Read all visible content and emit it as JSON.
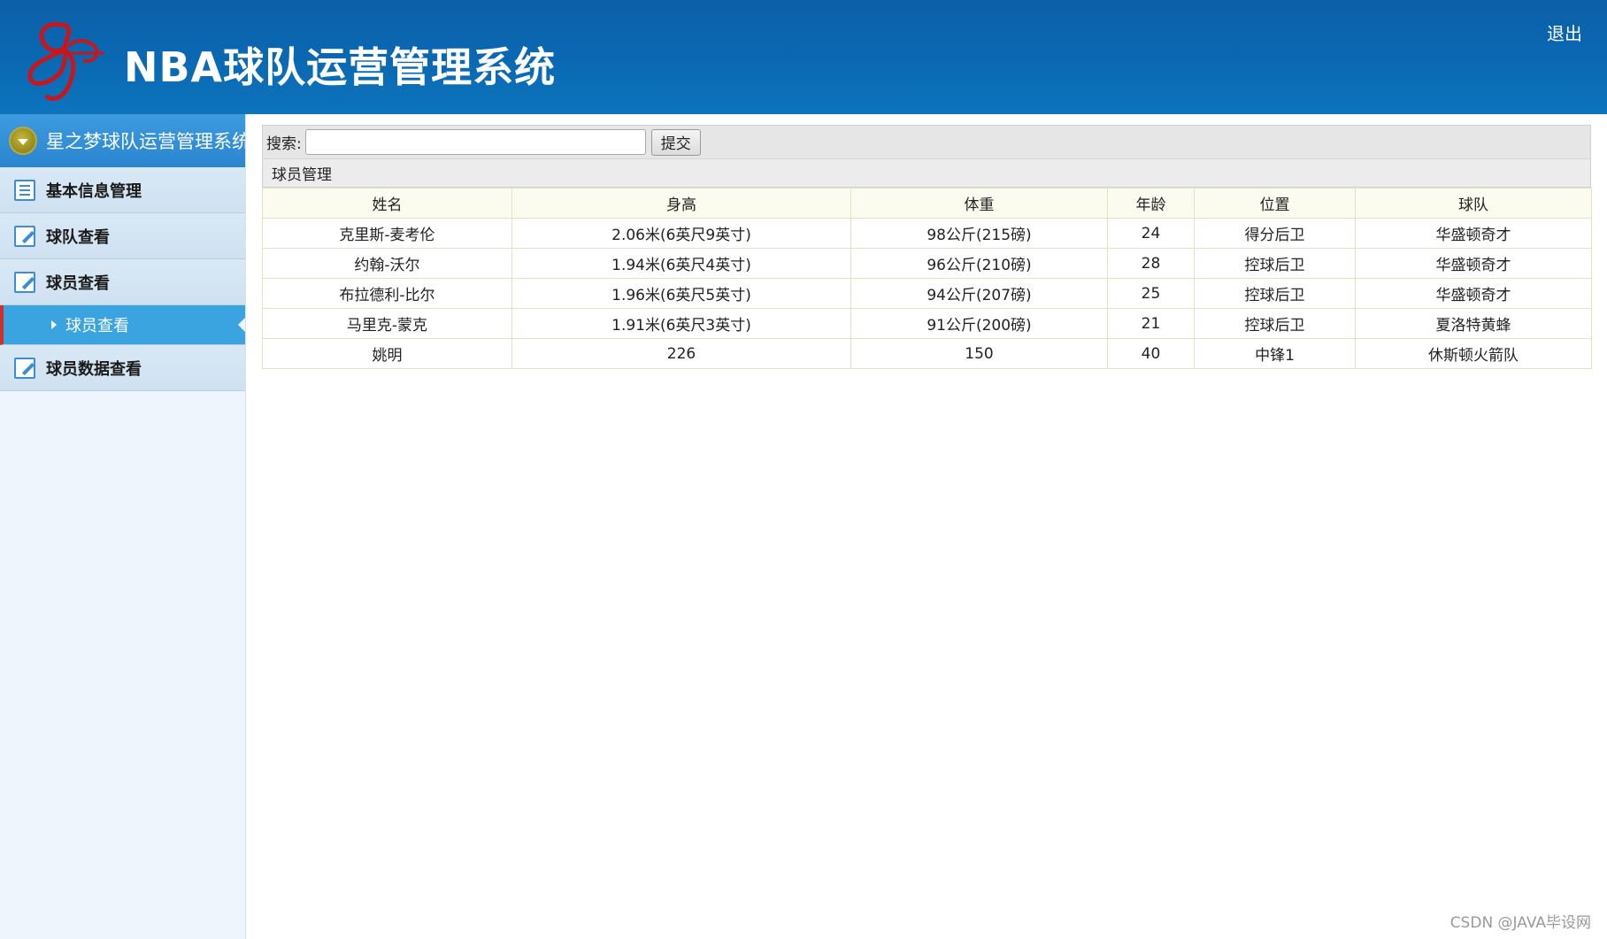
{
  "header": {
    "title": "NBA球队运营管理系统",
    "logout_label": "退出"
  },
  "sidebar": {
    "top_title": "星之梦球队运营管理系统",
    "items": [
      {
        "label": "基本信息管理",
        "icon": "list-icon"
      },
      {
        "label": "球队查看",
        "icon": "edit-icon"
      },
      {
        "label": "球员查看",
        "icon": "edit-icon"
      },
      {
        "label": "球员查看",
        "icon": "arrow-right-icon"
      },
      {
        "label": "球员数据查看",
        "icon": "edit-icon"
      }
    ]
  },
  "search": {
    "label": "搜索:",
    "value": "",
    "submit_label": "提交"
  },
  "section_title": "球员管理",
  "table": {
    "columns": [
      "姓名",
      "身高",
      "体重",
      "年龄",
      "位置",
      "球队"
    ],
    "rows": [
      [
        "克里斯-麦考伦",
        "2.06米(6英尺9英寸)",
        "98公斤(215磅)",
        "24",
        "得分后卫",
        "华盛顿奇才"
      ],
      [
        "约翰-沃尔",
        "1.94米(6英尺4英寸)",
        "96公斤(210磅)",
        "28",
        "控球后卫",
        "华盛顿奇才"
      ],
      [
        "布拉德利-比尔",
        "1.96米(6英尺5英寸)",
        "94公斤(207磅)",
        "25",
        "控球后卫",
        "华盛顿奇才"
      ],
      [
        "马里克-蒙克",
        "1.91米(6英尺3英寸)",
        "91公斤(200磅)",
        "21",
        "控球后卫",
        "夏洛特黄蜂"
      ],
      [
        "姚明",
        "226",
        "150",
        "40",
        "中锋1",
        "休斯顿火箭队"
      ]
    ]
  },
  "watermark": "CSDN @JAVA毕设网",
  "colors": {
    "header_bg": "#0a69b3",
    "sidebar_bg": "#eef5fc",
    "active_item": "#3aa4e0",
    "active_marker": "#d0302a"
  }
}
